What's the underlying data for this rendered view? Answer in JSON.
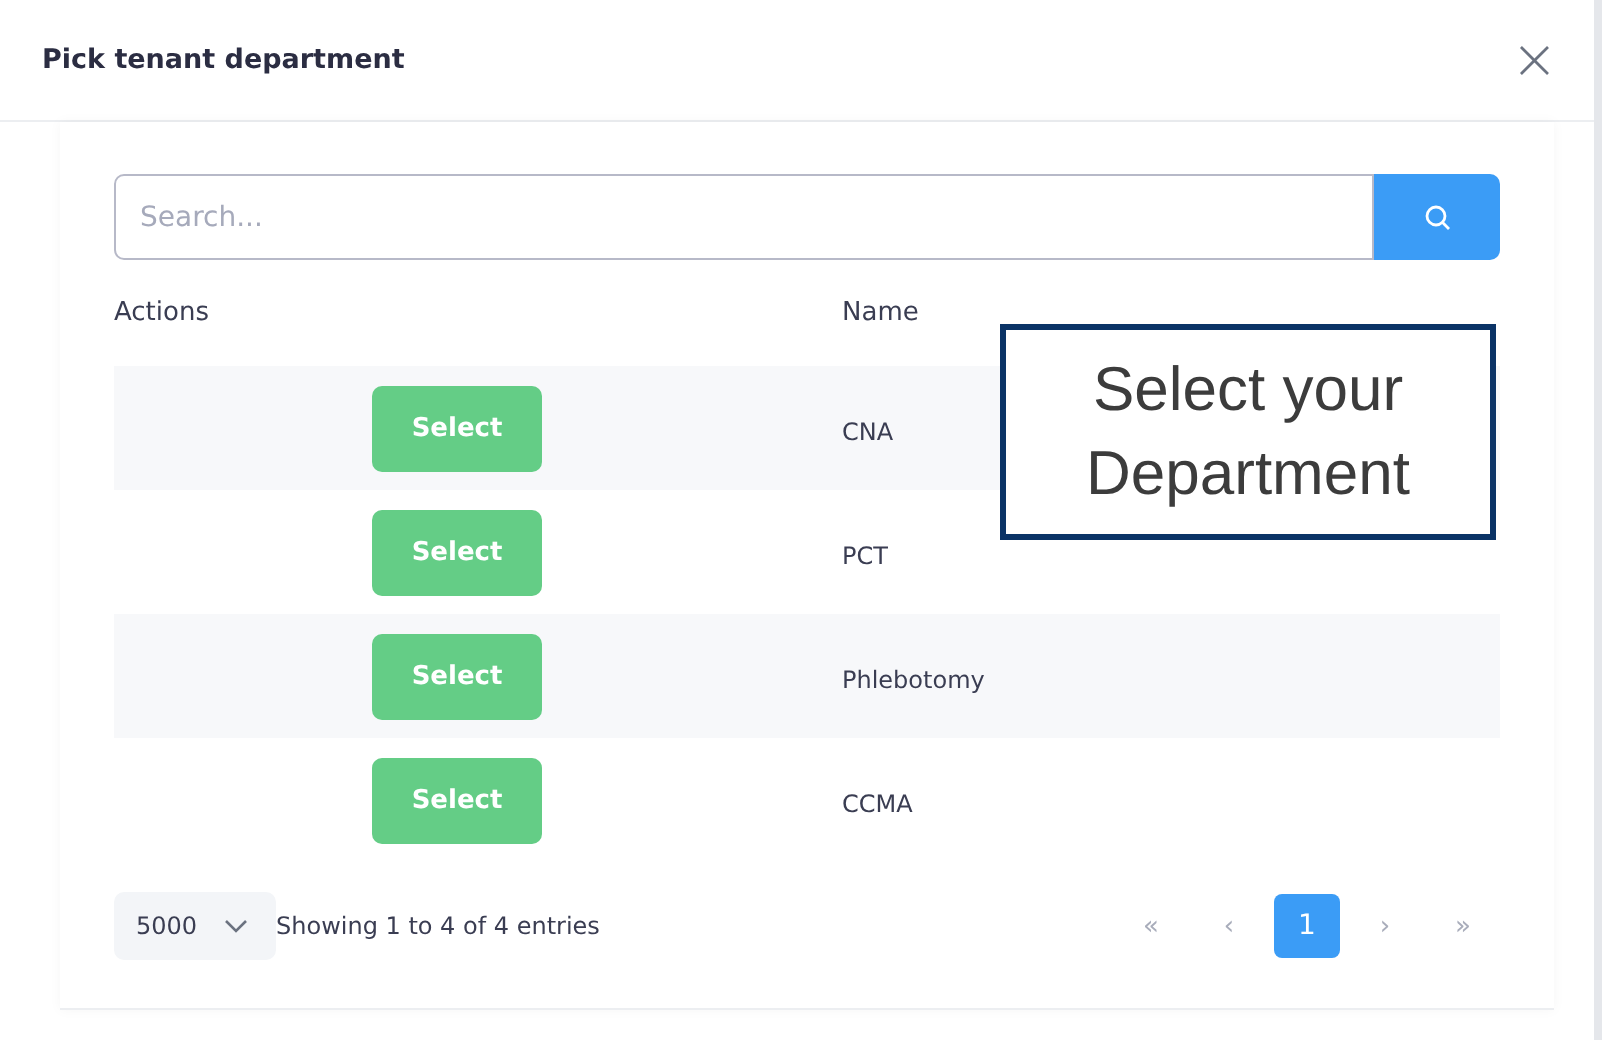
{
  "dialog": {
    "title": "Pick tenant department",
    "close": "×"
  },
  "search": {
    "placeholder": "Search..."
  },
  "table": {
    "columns": [
      "Actions",
      "Name"
    ],
    "rows": [
      {
        "action": "Select",
        "name": "CNA"
      },
      {
        "action": "Select",
        "name": "PCT"
      },
      {
        "action": "Select",
        "name": "Phlebotomy"
      },
      {
        "action": "Select",
        "name": "CCMA"
      }
    ]
  },
  "footer": {
    "page_size": "5000",
    "summary": "Showing 1 to 4 of 4 entries",
    "pagination": [
      {
        "label": "«",
        "kind": "nav",
        "selected": false
      },
      {
        "label": "‹",
        "kind": "nav",
        "selected": false
      },
      {
        "label": "1",
        "kind": "page",
        "selected": true
      },
      {
        "label": "›",
        "kind": "nav",
        "selected": false
      },
      {
        "label": "»",
        "kind": "nav",
        "selected": false
      }
    ]
  },
  "callout": {
    "text": "Select your Department"
  }
}
